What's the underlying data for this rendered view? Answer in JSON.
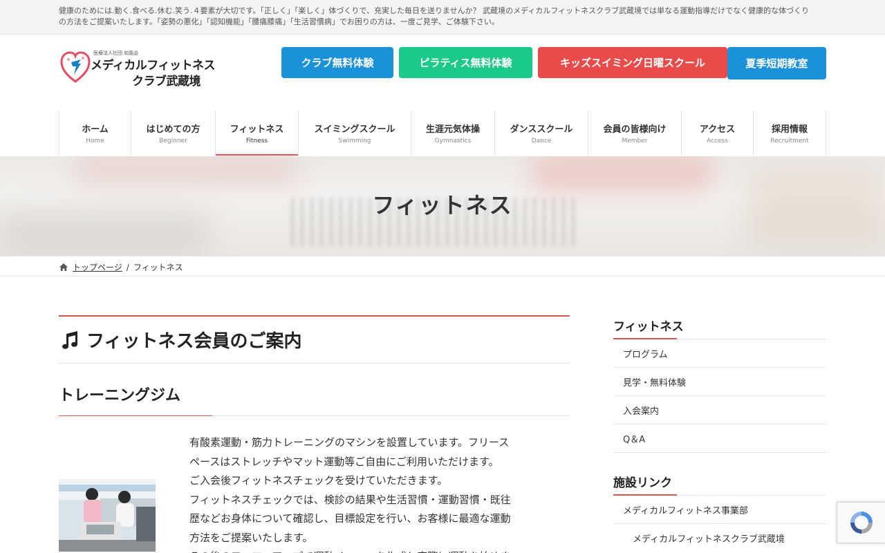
{
  "topbar": {
    "message": "健康のためには.動く.食べる.休む.笑う.４要素が大切です。「正しく」「楽しく」体づくりで、充実した毎日を送りませんか？ 武蔵境のメディカルフィットネスクラブ武蔵境では単なる運動指導だけでなく健康的な体づくりの方法をご提案いたします。「姿勢の悪化」「認知機能」「腰痛膝痛」「生活習慣病」でお困りの方は、一度ご見学、ご体験下さい。"
  },
  "logo": {
    "sub": "医療法人社団 和風会",
    "line1": "メディカルフィットネス",
    "line2": "クラブ武蔵境",
    "mark_color": "#e84b63"
  },
  "cta": [
    {
      "label": "クラブ無料体験",
      "color": "#1a91d9"
    },
    {
      "label": "ピラティス無料体験",
      "color": "#1bc98a"
    },
    {
      "label": "キッズスイミング日曜スクール",
      "color": "#e84b4a"
    },
    {
      "label": "夏季短期教室",
      "color": "#1a91d9"
    }
  ],
  "nav": [
    {
      "jp": "ホーム",
      "en": "Home"
    },
    {
      "jp": "はじめての方",
      "en": "Beginner"
    },
    {
      "jp": "フィットネス",
      "en": "Fitness"
    },
    {
      "jp": "スイミングスクール",
      "en": "Swimming"
    },
    {
      "jp": "生涯元気体操",
      "en": "Gymnastics"
    },
    {
      "jp": "ダンススクール",
      "en": "Dance"
    },
    {
      "jp": "会員の皆様向け",
      "en": "Member"
    },
    {
      "jp": "アクセス",
      "en": "Access"
    },
    {
      "jp": "採用情報",
      "en": "Recruitment"
    }
  ],
  "hero": {
    "title": "フィットネス"
  },
  "breadcrumb": {
    "home": "トップページ",
    "separator": "/",
    "current": "フィットネス"
  },
  "main": {
    "heading": "フィットネス会員のご案内",
    "subheading": "トレーニングジム",
    "paragraph_lines": [
      "有酸素運動・筋力トレーニングのマシンを設置しています。フリース",
      "ペースはストレッチやマット運動等ご自由にご利用いただけます。",
      "ご入会後フィットネスチェックを受けていただきます。",
      "フィットネスチェックでは、検診の結果や生活習慣・運動習慣・既往",
      "歴などお身体について確認し、目標設定を行い、お客様に最適な運動",
      "方法をご提案いたします。",
      "その後のフォローアップで運動メニューを作成し実際に運動を始めま"
    ]
  },
  "sidebar": {
    "section1": {
      "title": "フィットネス",
      "items": [
        "プログラム",
        "見学・無料体験",
        "入会案内",
        "Q＆A"
      ]
    },
    "section2": {
      "title": "施設リンク",
      "items": [
        "メディカルフィットネス事業部"
      ],
      "subitems": [
        "メディカルフィットネスクラブ武蔵境"
      ]
    }
  },
  "accent_color": "#d9534f"
}
